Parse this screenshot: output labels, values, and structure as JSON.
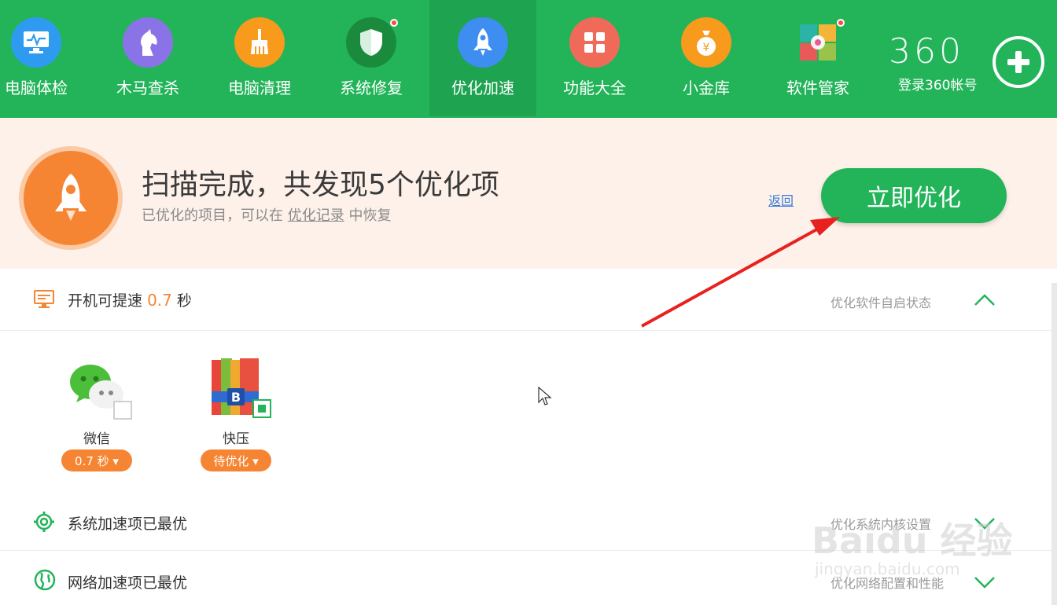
{
  "toolbar": {
    "items": [
      {
        "label": "电脑体检",
        "icon": "monitor-check-icon",
        "color": "#2e9bf0"
      },
      {
        "label": "木马查杀",
        "icon": "horse-icon",
        "color": "#8a73e6"
      },
      {
        "label": "电脑清理",
        "icon": "broom-icon",
        "color": "#f89a1c"
      },
      {
        "label": "系统修复",
        "icon": "shield-icon",
        "color": "#1a8a3c"
      },
      {
        "label": "优化加速",
        "icon": "rocket-icon",
        "color": "#3d8ef0"
      },
      {
        "label": "功能大全",
        "icon": "grid-icon",
        "color": "#f06a5a"
      },
      {
        "label": "小金库",
        "icon": "money-bag-icon",
        "color": "#f89a1c"
      },
      {
        "label": "软件管家",
        "icon": "software-icon",
        "color": "#e85a9a"
      }
    ],
    "logo": "360",
    "login": "登录360帐号"
  },
  "banner": {
    "title": "扫描完成，共发现5个优化项",
    "subtitle_prefix": "已优化的项目，可以在",
    "subtitle_link": "优化记录",
    "subtitle_suffix": "中恢复",
    "back": "返回",
    "optimize_button": "立即优化"
  },
  "startup": {
    "title_prefix": "开机可提速",
    "seconds": "0.7",
    "title_suffix": "秒",
    "right_text": "优化软件自启状态",
    "apps": [
      {
        "name": "微信",
        "badge": "0.7 秒 ▾",
        "checked": false
      },
      {
        "name": "快压",
        "badge": "待优化 ▾",
        "checked": true
      }
    ]
  },
  "system_row": {
    "title": "系统加速项已最优",
    "right_text": "优化系统内核设置"
  },
  "network_row": {
    "title": "网络加速项已最优",
    "right_text": "优化网络配置和性能"
  },
  "watermark": {
    "main": "Baidu 经验",
    "sub": "jingyan.baidu.com"
  },
  "colors": {
    "green": "#23b45a",
    "orange": "#f68533",
    "banner_bg": "#fdf1ea"
  }
}
